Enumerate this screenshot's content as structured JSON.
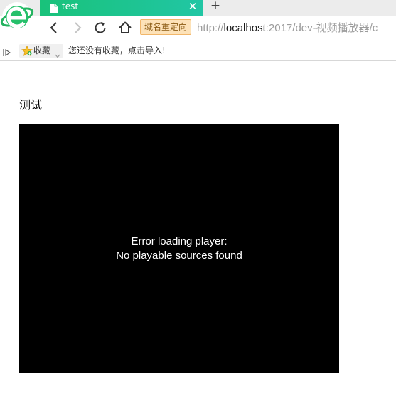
{
  "browser": {
    "tab": {
      "title": "test",
      "close_label": "✕"
    },
    "new_tab_label": "+",
    "nav": {
      "redirect_badge": "域名重定向",
      "url": {
        "prefix": "http://",
        "host": "localhost",
        "rest": ":2017/dev-视频播放器/c"
      }
    },
    "bookmarks": {
      "favorites_label": "收藏",
      "empty_message": "您还没有收藏，点击导入!"
    },
    "colors": {
      "tab_green": "#19c27a",
      "badge_bg": "#fde2b8",
      "badge_text": "#8a5a12"
    }
  },
  "page": {
    "heading": "测试",
    "player": {
      "error_line1": "Error loading player:",
      "error_line2": "No playable sources found"
    }
  }
}
